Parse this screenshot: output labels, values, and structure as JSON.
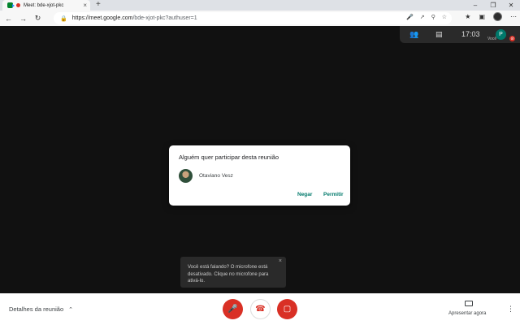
{
  "browser": {
    "tab_title": "Meet: bde-xjot-pkc",
    "tab_close": "×",
    "new_tab": "+",
    "win_min": "–",
    "win_max": "❐",
    "win_close": "✕",
    "back": "←",
    "forward": "→",
    "reload": "↻",
    "url_host": "https://meet.google.com",
    "url_path": "/bde-xjot-pkc?authuser=1",
    "icons": [
      "lock-icon",
      "mic-icon",
      "share-icon",
      "zoom-icon",
      "star-icon",
      "extensions-icon",
      "collections-icon",
      "profile-avatar"
    ]
  },
  "meet": {
    "clock": "17:03",
    "you_avatar": "P",
    "you_label": "Você",
    "dialog": {
      "title": "Alguém quer participar desta reunião",
      "guest_name": "Otaviano Vesz",
      "deny_label": "Negar",
      "allow_label": "Permitir"
    },
    "toast": {
      "text": "Você está falando? O microfone está desativado. Clique no microfone para ativá-lo.",
      "close": "×"
    },
    "bottom": {
      "details_label": "Detalhes da reunião",
      "present_label": "Apresentar agora"
    }
  },
  "colors": {
    "accent": "#00796b",
    "danger": "#d93025",
    "background": "#111111"
  }
}
